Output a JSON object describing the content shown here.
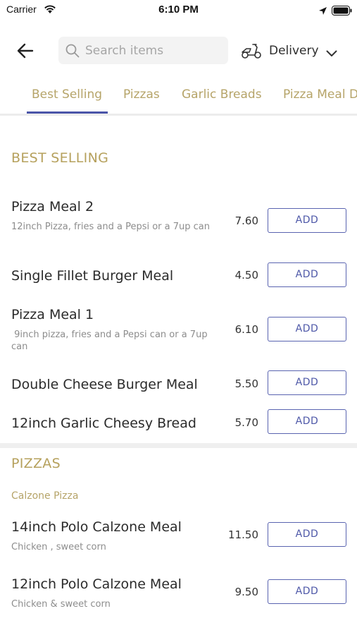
{
  "status_bar": {
    "carrier": "Carrier",
    "time": "6:10 PM"
  },
  "header": {
    "search_placeholder": "Search items",
    "delivery_label": "Delivery"
  },
  "tabs": [
    {
      "label": "Best Selling",
      "active": true
    },
    {
      "label": "Pizzas",
      "active": false
    },
    {
      "label": "Garlic Breads",
      "active": false
    },
    {
      "label": "Pizza Meal D",
      "active": false
    }
  ],
  "add_label": "ADD",
  "sections": [
    {
      "title": "BEST SELLING",
      "items": [
        {
          "name": "Pizza Meal 2",
          "description": "12inch Pizza, fries and a Pepsi or a 7up can",
          "price": "7.60"
        },
        {
          "name": "Single Fillet Burger Meal",
          "description": "",
          "price": "4.50"
        },
        {
          "name": "Pizza Meal 1",
          "description": " 9inch pizza, fries and a Pepsi can or a 7up can",
          "price": "6.10"
        },
        {
          "name": "Double Cheese Burger Meal",
          "description": "",
          "price": "5.50"
        },
        {
          "name": "12inch Garlic Cheesy Bread",
          "description": "",
          "price": "5.70"
        }
      ]
    },
    {
      "title": "PIZZAS",
      "subtitle": "Calzone Pizza",
      "items": [
        {
          "name": "14inch Polo Calzone Meal",
          "description": "Chicken , sweet corn",
          "price": "11.50"
        },
        {
          "name": "12inch Polo Calzone Meal",
          "description": "Chicken & sweet corn",
          "price": "9.50"
        }
      ]
    }
  ],
  "colors": {
    "accent": "#4b55a8",
    "section_gold": "#b6a15d",
    "tab_gold": "#b6a469"
  }
}
